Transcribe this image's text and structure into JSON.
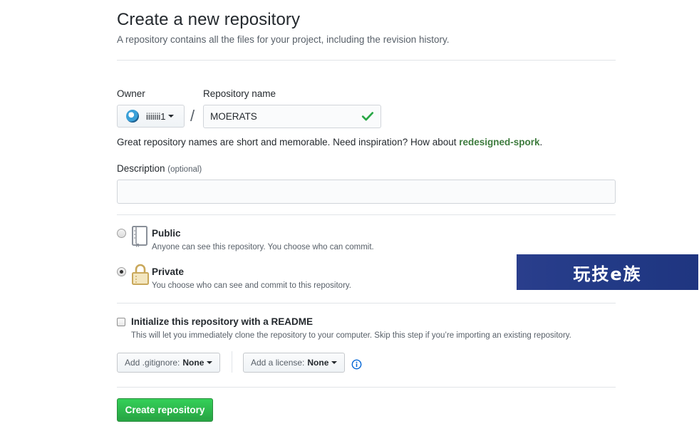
{
  "header": {
    "title": "Create a new repository",
    "subtitle": "A repository contains all the files for your project, including the revision history."
  },
  "owner": {
    "label": "Owner",
    "value": "iiiiiii1",
    "avatar_icon": "avatar-icon"
  },
  "separator": "/",
  "repository": {
    "label": "Repository name",
    "value": "MOERATS",
    "status_icon": "check-icon",
    "status_color": "#28a745"
  },
  "hint": {
    "text": "Great repository names are short and memorable. Need inspiration? How about ",
    "suggestion": "redesigned-spork",
    "end": "."
  },
  "description": {
    "label": "Description",
    "optional": "(optional)",
    "value": ""
  },
  "visibility": {
    "public": {
      "title": "Public",
      "note": "Anyone can see this repository. You choose who can commit.",
      "icon": "repo-book-icon",
      "selected": false
    },
    "private": {
      "title": "Private",
      "note": "You choose who can see and commit to this repository.",
      "icon": "lock-icon",
      "selected": true
    }
  },
  "readme": {
    "title": "Initialize this repository with a README",
    "note": "This will let you immediately clone the repository to your computer. Skip this step if you’re importing an existing repository.",
    "checked": false
  },
  "gitignore": {
    "label": "Add .gitignore:",
    "value": "None"
  },
  "license": {
    "label": "Add a license:",
    "value": "None"
  },
  "info_icon": "info-icon",
  "submit": {
    "label": "Create repository",
    "color": "#28a745"
  },
  "watermark": {
    "text": "玩技e族",
    "color": "#223a86"
  }
}
